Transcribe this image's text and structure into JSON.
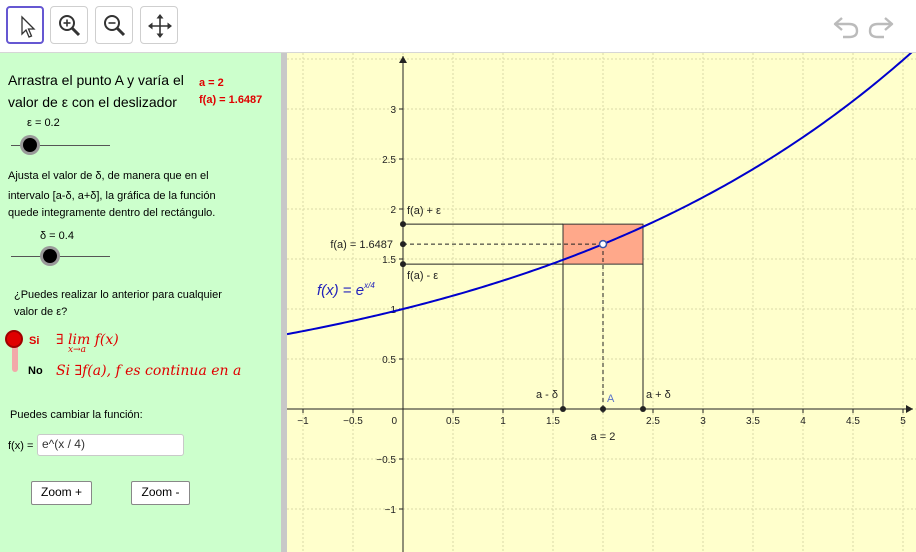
{
  "toolbar": {
    "tools": [
      "move-tool",
      "zoom-in-tool",
      "zoom-out-tool",
      "move-graphics-view-tool"
    ],
    "accent": "#6557d2"
  },
  "panel": {
    "intro": [
      "Arrastra el punto A y varía el",
      "valor de ε con el deslizador"
    ],
    "a_text": "a = 2",
    "fa_text": "f(a) = 1.6487",
    "eps_label": "ε = 0.2",
    "eps_value": 0.2,
    "instructions": [
      "Ajusta el valor de δ, de manera que en el",
      "intervalo [a-δ, a+δ], la gráfica de la función",
      "quede integramente dentro del rectángulo."
    ],
    "delta_label": "δ = 0.4",
    "delta_value": 0.4,
    "question": [
      "¿Puedes realizar lo anterior para cualquier",
      "valor de ε?"
    ],
    "yes_label": "Si",
    "no_label": "No",
    "yes_answer": "∃ lim f(x)",
    "yes_sub": "x→a",
    "no_answer": "Si ∃f(a),  f es continua en a",
    "change_label": "Puedes cambiar la función:",
    "fx_label": "f(x) =",
    "fx_value": "e^(x / 4)",
    "zoom_in": "Zoom +",
    "zoom_out": "Zoom -"
  },
  "graph": {
    "x_ticks": [
      "−1",
      "−0.5",
      "0.5",
      "1",
      "1.5",
      "2",
      "2.5",
      "3",
      "3.5",
      "4",
      "4.5",
      "5"
    ],
    "y_ticks": [
      "3",
      "2.5",
      "2",
      "1.5",
      "1",
      "0.5",
      "−0.5",
      "−1"
    ],
    "zero_label": "0",
    "label_fa_plus": "f(a) + ε",
    "label_fa": "f(a) = 1.6487",
    "label_fa_minus": "f(a) - ε",
    "label_a_minus": "a - δ",
    "label_a_plus": "a + δ",
    "label_a": "a = 2",
    "point_label": "A",
    "fx_formula_lhs": "f(x)",
    "fx_formula_eq": "=",
    "fx_formula_base": "e",
    "fx_formula_exp": "x/4",
    "curve_color": "#0000cc",
    "rect_color": "#ffa88a",
    "a": 2,
    "fa": 1.6487,
    "epsilon": 0.2,
    "delta": 0.4
  }
}
